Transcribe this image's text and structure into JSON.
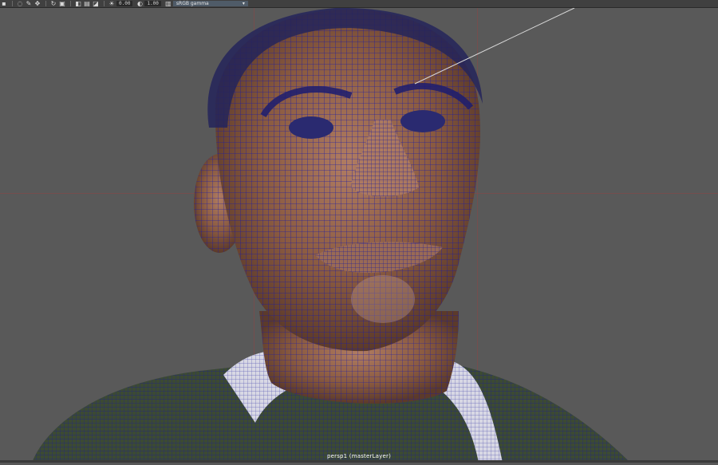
{
  "toolbar": {
    "icons": [
      "select-icon",
      "lasso-icon",
      "paint-icon",
      "move-icon",
      "rotate-icon",
      "scale-icon",
      "camera-icon",
      "gate-icon",
      "snapshot-icon"
    ],
    "exposure_value": "0.00",
    "gamma_value": "1.00",
    "colorspace": "sRGB gamma",
    "dropdown_glyph": "▾"
  },
  "viewport": {
    "camera_label": "persp1 (masterLayer)",
    "wire_color": "#1a1aa8",
    "skin_color": "#8a5a40",
    "shirt_color": "#3c4a33",
    "collar_color": "#d8d8e4"
  }
}
